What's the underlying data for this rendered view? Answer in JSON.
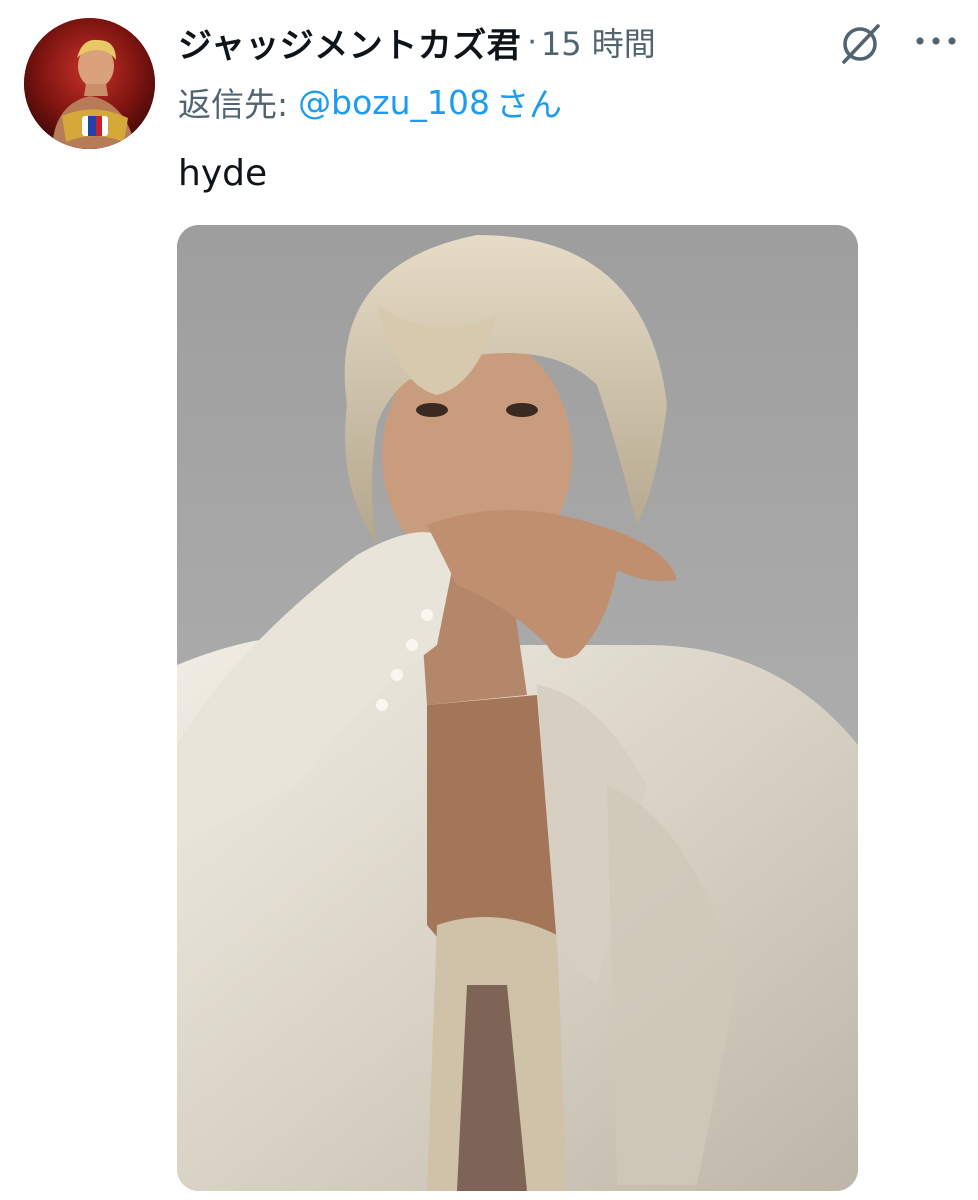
{
  "tweet": {
    "display_name": "ジャッジメントカズ君",
    "separator": "·",
    "timestamp": "15 時間",
    "reply": {
      "prefix": "返信先:",
      "handle": "@bozu_108",
      "suffix": "さん"
    },
    "text": "hyde",
    "icons": {
      "grok": "grok-slash-circle-icon",
      "more": "more-horizontal-icon"
    },
    "media": {
      "type": "photo",
      "subject": "portrait-photo"
    }
  },
  "colors": {
    "text_primary": "#0f1419",
    "text_secondary": "#536471",
    "link": "#1d9bf0",
    "background": "#ffffff"
  }
}
